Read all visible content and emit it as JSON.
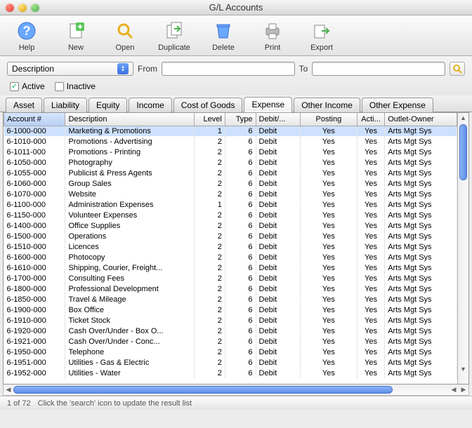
{
  "window": {
    "title": "G/L Accounts"
  },
  "toolbar": {
    "help": "Help",
    "new": "New",
    "open": "Open",
    "duplicate": "Duplicate",
    "delete": "Delete",
    "print": "Print",
    "export": "Export"
  },
  "filter": {
    "field": "Description",
    "from_label": "From",
    "to_label": "To",
    "from_value": "",
    "to_value": "",
    "active_label": "Active",
    "active_checked": true,
    "inactive_label": "Inactive",
    "inactive_checked": false
  },
  "tabs": {
    "items": [
      "Asset",
      "Liability",
      "Equity",
      "Income",
      "Cost of Goods",
      "Expense",
      "Other Income",
      "Other Expense"
    ],
    "active_index": 5
  },
  "columns": [
    "Account #",
    "Description",
    "Level",
    "Type",
    "Debit/...",
    "Posting",
    "Acti...",
    "Outlet-Owner"
  ],
  "rows": [
    {
      "acc": "6-1000-000",
      "desc": "Marketing & Promotions",
      "lvl": "1",
      "type": "6",
      "dc": "Debit",
      "post": "Yes",
      "act": "Yes",
      "own": "Arts Mgt Sys",
      "sel": true
    },
    {
      "acc": "6-1010-000",
      "desc": "Promotions - Advertising",
      "lvl": "2",
      "type": "6",
      "dc": "Debit",
      "post": "Yes",
      "act": "Yes",
      "own": "Arts Mgt Sys"
    },
    {
      "acc": "6-1011-000",
      "desc": "Promotions - Printing",
      "lvl": "2",
      "type": "6",
      "dc": "Debit",
      "post": "Yes",
      "act": "Yes",
      "own": "Arts Mgt Sys"
    },
    {
      "acc": "6-1050-000",
      "desc": "Photography",
      "lvl": "2",
      "type": "6",
      "dc": "Debit",
      "post": "Yes",
      "act": "Yes",
      "own": "Arts Mgt Sys"
    },
    {
      "acc": "6-1055-000",
      "desc": "Publicist & Press Agents",
      "lvl": "2",
      "type": "6",
      "dc": "Debit",
      "post": "Yes",
      "act": "Yes",
      "own": "Arts Mgt Sys"
    },
    {
      "acc": "6-1060-000",
      "desc": "Group Sales",
      "lvl": "2",
      "type": "6",
      "dc": "Debit",
      "post": "Yes",
      "act": "Yes",
      "own": "Arts Mgt Sys"
    },
    {
      "acc": "6-1070-000",
      "desc": "Website",
      "lvl": "2",
      "type": "6",
      "dc": "Debit",
      "post": "Yes",
      "act": "Yes",
      "own": "Arts Mgt Sys"
    },
    {
      "acc": "6-1100-000",
      "desc": "Administration Expenses",
      "lvl": "1",
      "type": "6",
      "dc": "Debit",
      "post": "Yes",
      "act": "Yes",
      "own": "Arts Mgt Sys"
    },
    {
      "acc": "6-1150-000",
      "desc": "Volunteer Expenses",
      "lvl": "2",
      "type": "6",
      "dc": "Debit",
      "post": "Yes",
      "act": "Yes",
      "own": "Arts Mgt Sys"
    },
    {
      "acc": "6-1400-000",
      "desc": "Office Supplies",
      "lvl": "2",
      "type": "6",
      "dc": "Debit",
      "post": "Yes",
      "act": "Yes",
      "own": "Arts Mgt Sys"
    },
    {
      "acc": "6-1500-000",
      "desc": "Operations",
      "lvl": "2",
      "type": "6",
      "dc": "Debit",
      "post": "Yes",
      "act": "Yes",
      "own": "Arts Mgt Sys"
    },
    {
      "acc": "6-1510-000",
      "desc": "Licences",
      "lvl": "2",
      "type": "6",
      "dc": "Debit",
      "post": "Yes",
      "act": "Yes",
      "own": "Arts Mgt Sys"
    },
    {
      "acc": "6-1600-000",
      "desc": "Photocopy",
      "lvl": "2",
      "type": "6",
      "dc": "Debit",
      "post": "Yes",
      "act": "Yes",
      "own": "Arts Mgt Sys"
    },
    {
      "acc": "6-1610-000",
      "desc": "Shipping, Courier, Freight...",
      "lvl": "2",
      "type": "6",
      "dc": "Debit",
      "post": "Yes",
      "act": "Yes",
      "own": "Arts Mgt Sys"
    },
    {
      "acc": "6-1700-000",
      "desc": "Consulting Fees",
      "lvl": "2",
      "type": "6",
      "dc": "Debit",
      "post": "Yes",
      "act": "Yes",
      "own": "Arts Mgt Sys"
    },
    {
      "acc": "6-1800-000",
      "desc": "Professional Development",
      "lvl": "2",
      "type": "6",
      "dc": "Debit",
      "post": "Yes",
      "act": "Yes",
      "own": "Arts Mgt Sys"
    },
    {
      "acc": "6-1850-000",
      "desc": "Travel & Mileage",
      "lvl": "2",
      "type": "6",
      "dc": "Debit",
      "post": "Yes",
      "act": "Yes",
      "own": "Arts Mgt Sys"
    },
    {
      "acc": "6-1900-000",
      "desc": "Box Office",
      "lvl": "2",
      "type": "6",
      "dc": "Debit",
      "post": "Yes",
      "act": "Yes",
      "own": "Arts Mgt Sys"
    },
    {
      "acc": "6-1910-000",
      "desc": "Ticket Stock",
      "lvl": "2",
      "type": "6",
      "dc": "Debit",
      "post": "Yes",
      "act": "Yes",
      "own": "Arts Mgt Sys"
    },
    {
      "acc": "6-1920-000",
      "desc": "Cash Over/Under - Box O...",
      "lvl": "2",
      "type": "6",
      "dc": "Debit",
      "post": "Yes",
      "act": "Yes",
      "own": "Arts Mgt Sys"
    },
    {
      "acc": "6-1921-000",
      "desc": "Cash Over/Under - Conc...",
      "lvl": "2",
      "type": "6",
      "dc": "Debit",
      "post": "Yes",
      "act": "Yes",
      "own": "Arts Mgt Sys"
    },
    {
      "acc": "6-1950-000",
      "desc": "Telephone",
      "lvl": "2",
      "type": "6",
      "dc": "Debit",
      "post": "Yes",
      "act": "Yes",
      "own": "Arts Mgt Sys"
    },
    {
      "acc": "6-1951-000",
      "desc": "Utilities - Gas & Electric",
      "lvl": "2",
      "type": "6",
      "dc": "Debit",
      "post": "Yes",
      "act": "Yes",
      "own": "Arts Mgt Sys"
    },
    {
      "acc": "6-1952-000",
      "desc": "Utilities - Water",
      "lvl": "2",
      "type": "6",
      "dc": "Debit",
      "post": "Yes",
      "act": "Yes",
      "own": "Arts Mgt Sys"
    }
  ],
  "status": {
    "count": "1 of 72",
    "hint": "Click the 'search' icon to update the result list"
  }
}
